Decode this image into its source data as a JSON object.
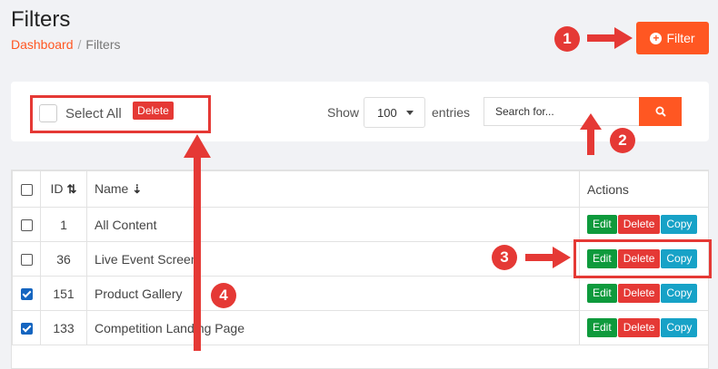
{
  "page": {
    "title": "Filters"
  },
  "breadcrumb": {
    "home": "Dashboard",
    "separator": "/",
    "current": "Filters"
  },
  "add_filter_button": {
    "label": "Filter",
    "icon": "plus-circle-icon"
  },
  "toolbar": {
    "select_all_label": "Select All",
    "delete_label": "Delete",
    "show_label": "Show",
    "entries_value": "100",
    "entries_label": "entries",
    "search_placeholder": "Search for...",
    "search_icon": "search-icon"
  },
  "table": {
    "columns": {
      "id": "ID",
      "name": "Name",
      "actions": "Actions"
    },
    "sort_id_icon": "⇅",
    "sort_name_icon": "⇣",
    "action_labels": {
      "edit": "Edit",
      "delete": "Delete",
      "copy": "Copy"
    },
    "rows": [
      {
        "id": "1",
        "name": "All Content",
        "checked": false
      },
      {
        "id": "36",
        "name": "Live Event Screen",
        "checked": false
      },
      {
        "id": "151",
        "name": "Product Gallery",
        "checked": true
      },
      {
        "id": "133",
        "name": "Competition Landing Page",
        "checked": true
      }
    ]
  },
  "annotations": {
    "color": "#e53935",
    "markers": [
      "1",
      "2",
      "3",
      "4"
    ]
  },
  "colors": {
    "accent": "#ff5722",
    "danger": "#e53935",
    "success": "#0e9a3c",
    "info": "#17a2c7"
  }
}
